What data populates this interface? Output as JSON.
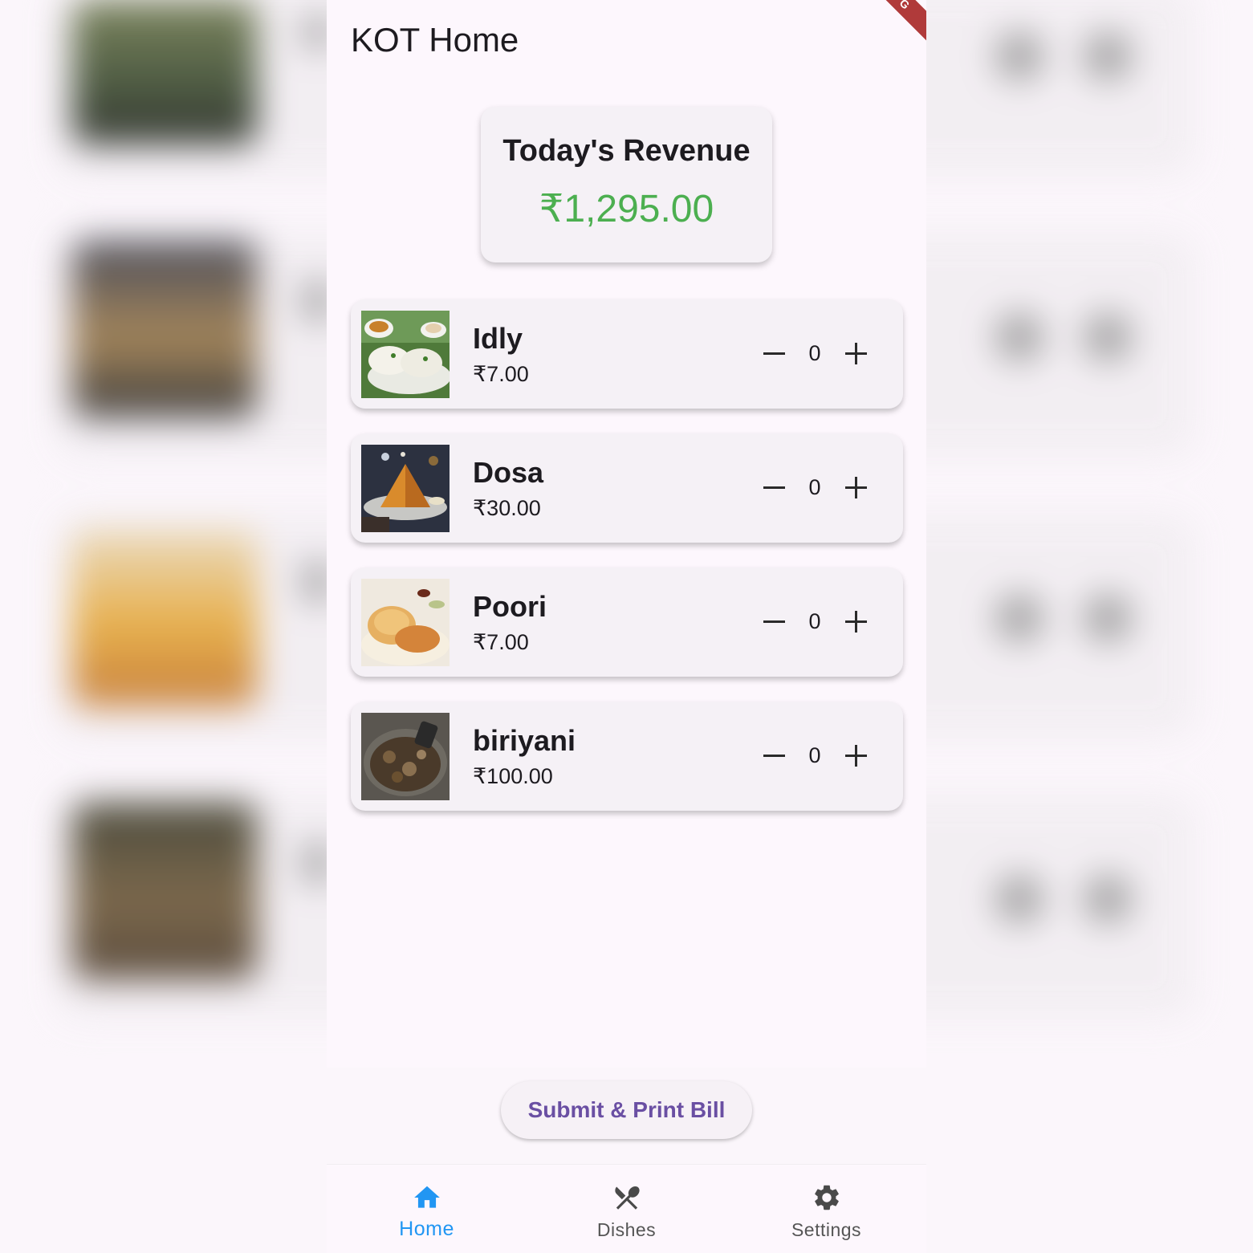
{
  "app": {
    "title": "KOT Home",
    "debug_banner": "G"
  },
  "revenue": {
    "title": "Today's Revenue",
    "amount": "₹1,295.00",
    "amount_color": "#4caf50"
  },
  "dishes": [
    {
      "name": "Idly",
      "price": "₹7.00",
      "quantity": "0",
      "image": "idly-photo"
    },
    {
      "name": "Dosa",
      "price": "₹30.00",
      "quantity": "0",
      "image": "dosa-photo"
    },
    {
      "name": "Poori",
      "price": "₹7.00",
      "quantity": "0",
      "image": "poori-photo"
    },
    {
      "name": "biriyani",
      "price": "₹100.00",
      "quantity": "0",
      "image": "biriyani-photo"
    }
  ],
  "actions": {
    "submit_label": "Submit & Print Bill",
    "submit_color": "#6a4fa3"
  },
  "nav": {
    "items": [
      {
        "label": "Home",
        "icon": "home-icon",
        "active": true,
        "color": "#2196f3"
      },
      {
        "label": "Dishes",
        "icon": "fork-knife-icon",
        "active": false
      },
      {
        "label": "Settings",
        "icon": "gear-icon",
        "active": false
      }
    ]
  }
}
